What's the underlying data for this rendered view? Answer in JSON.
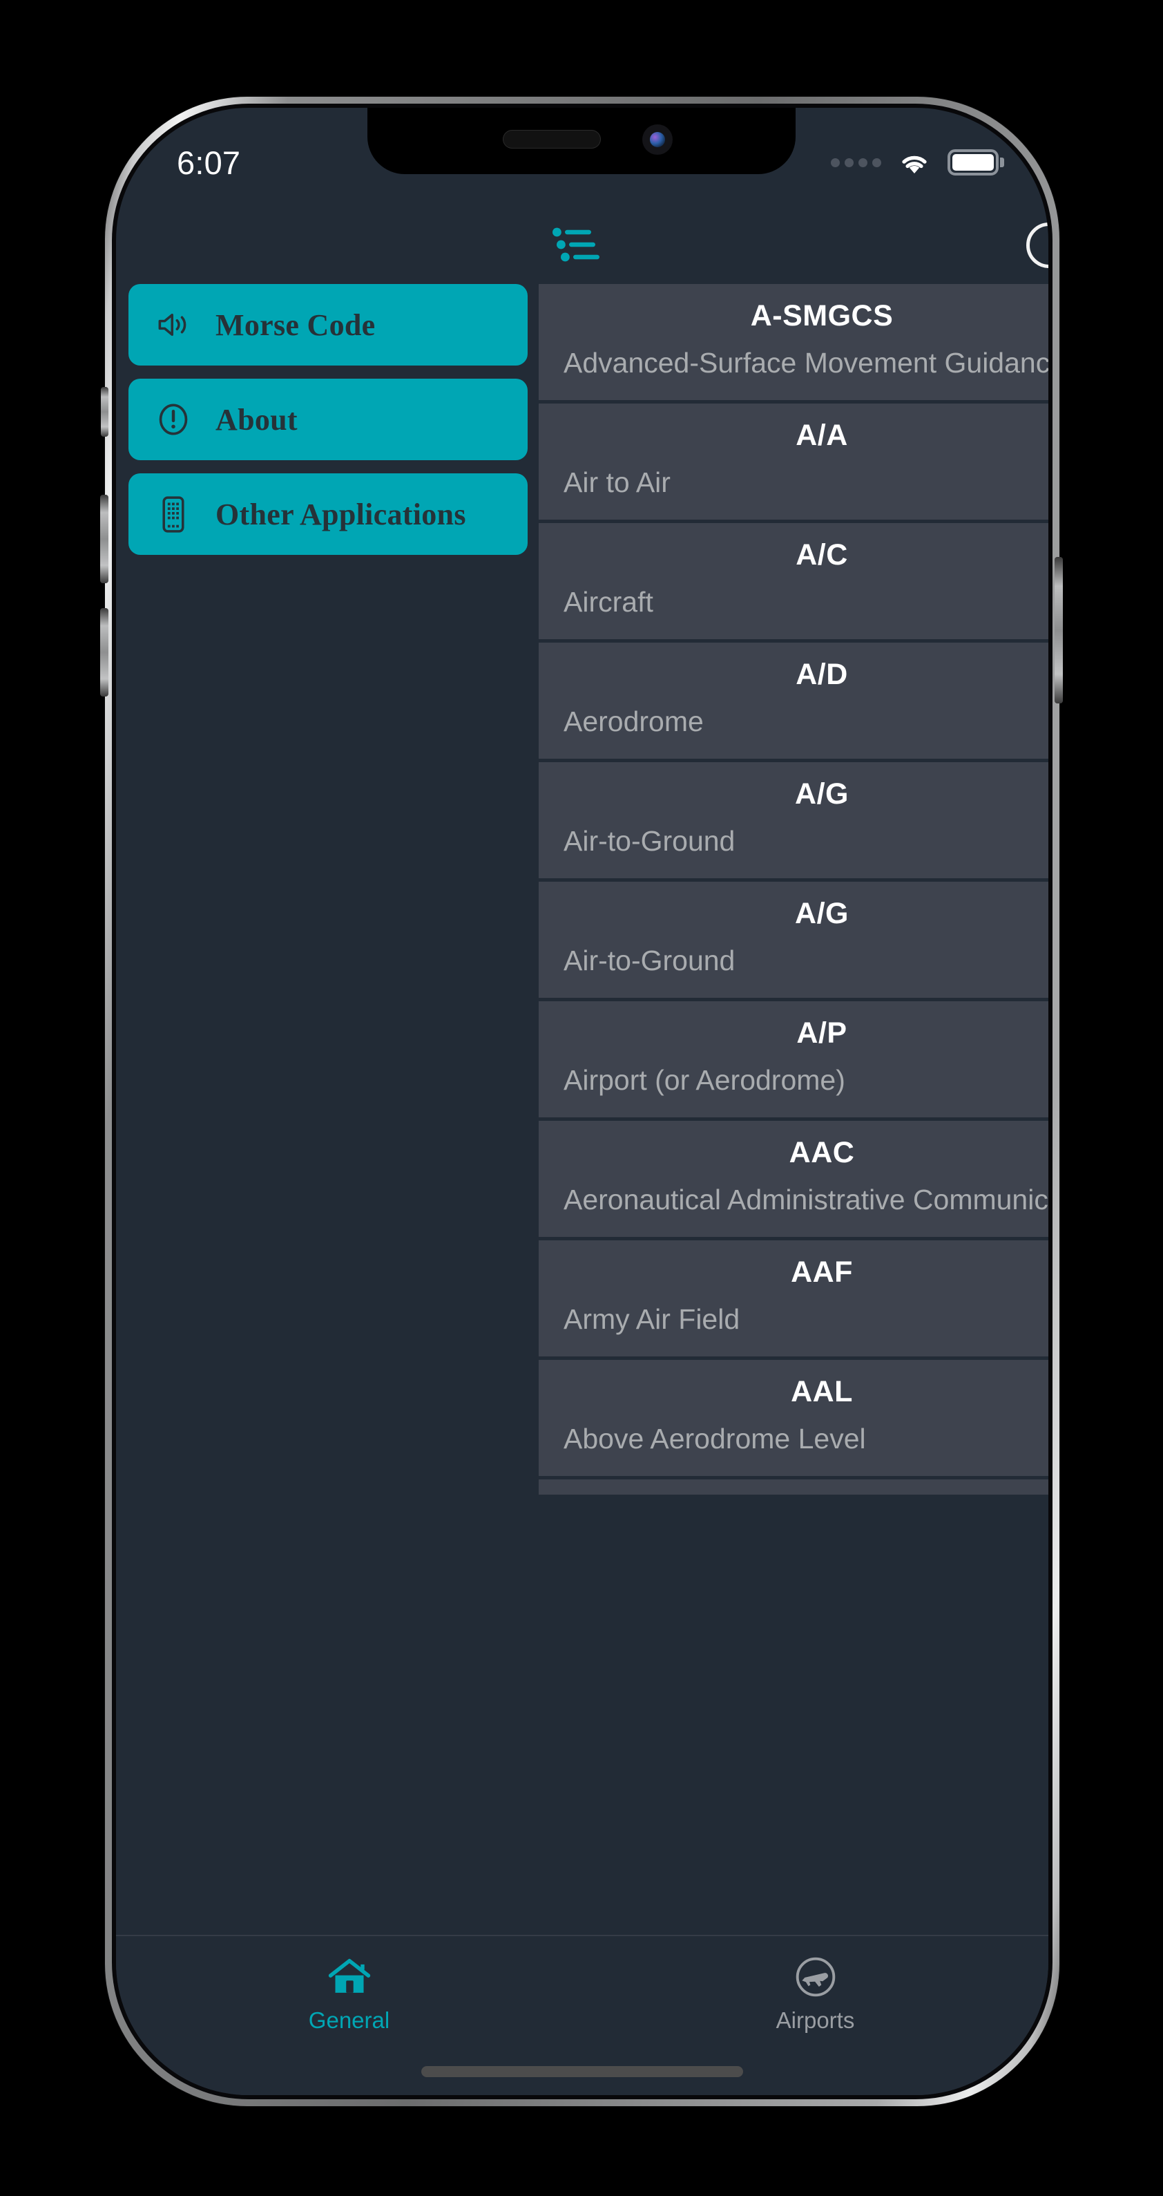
{
  "status_bar": {
    "time": "6:07",
    "signal_icon": "signal-dots-icon",
    "wifi_icon": "wifi-icon",
    "battery_icon": "battery-full-icon"
  },
  "nav_bar": {
    "list_icon": "staggered-list-icon",
    "right_icon": "circle-icon"
  },
  "theme": {
    "accent": "#00a6b4",
    "screen_bg": "#222b36",
    "card_bg": "#3e434e",
    "title_text": "#ffffff",
    "subtitle_text": "#a9acaf",
    "button_text": "#263238"
  },
  "sidebar": {
    "items": [
      {
        "label": "Morse Code",
        "icon": "speaker-wave-icon"
      },
      {
        "label": "About",
        "icon": "exclamation-circle-icon"
      },
      {
        "label": "Other Applications",
        "icon": "mobile-device-icon"
      }
    ]
  },
  "main_list": {
    "rows": [
      {
        "code": "A-SMGCS",
        "desc": "Advanced-Surface Movement Guidance and Control System"
      },
      {
        "code": "A/A",
        "desc": "Air to Air"
      },
      {
        "code": "A/C",
        "desc": "Aircraft"
      },
      {
        "code": "A/D",
        "desc": "Aerodrome"
      },
      {
        "code": "A/G",
        "desc": "Air-to-Ground"
      },
      {
        "code": "A/G",
        "desc": "Air-to-Ground"
      },
      {
        "code": "A/P",
        "desc": "Airport (or Aerodrome)"
      },
      {
        "code": "AAC",
        "desc": "Aeronautical Administrative Communications"
      },
      {
        "code": "AAF",
        "desc": "Army Air Field"
      },
      {
        "code": "AAL",
        "desc": "Above Aerodrome Level"
      }
    ]
  },
  "tab_bar": {
    "tabs": [
      {
        "label": "General",
        "icon": "home-icon",
        "active": true
      },
      {
        "label": "Airports",
        "icon": "airplane-circle-icon",
        "active": false
      }
    ]
  }
}
